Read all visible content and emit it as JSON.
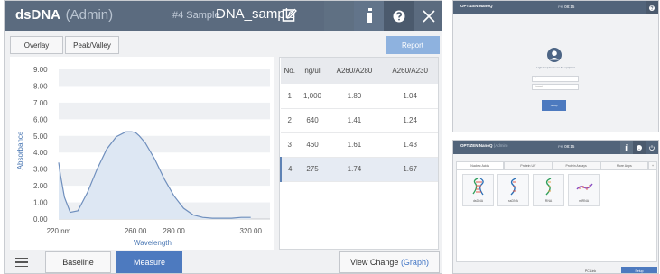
{
  "app": {
    "title": "dsDNA",
    "role": "(Admin)",
    "sample_no": "#4 Sample",
    "sample_name": "DNA_sample"
  },
  "toolbar": {
    "overlay_label": "Overlay",
    "peak_valley_label": "Peak/Valley",
    "report_label": "Report"
  },
  "chart_data": {
    "type": "line",
    "title": "",
    "xlabel": "Wavelength",
    "ylabel": "Absorbance",
    "xlim": [
      220,
      330
    ],
    "ylim": [
      0,
      9
    ],
    "x_tick_labels": [
      "220 nm",
      "260.00",
      "280.00",
      "320.00"
    ],
    "x_tick_values": [
      220,
      260,
      280,
      320
    ],
    "y_ticks": [
      "0.00",
      "1.00",
      "2.00",
      "3.00",
      "4.00",
      "5.00",
      "6.00",
      "7.00",
      "8.00",
      "9.00"
    ],
    "grid": "horizontal bands",
    "series": [
      {
        "x": [
          220,
          221,
          223,
          226,
          230,
          235,
          240,
          245,
          250,
          255,
          258,
          260,
          262,
          265,
          270,
          275,
          280,
          285,
          290,
          295,
          300,
          305,
          310,
          315,
          320
        ],
        "y": [
          3.4,
          2.6,
          1.3,
          0.4,
          0.5,
          1.6,
          3.0,
          4.2,
          4.95,
          5.25,
          5.25,
          5.2,
          5.0,
          4.6,
          3.6,
          2.4,
          1.4,
          0.65,
          0.25,
          0.1,
          0.05,
          0.05,
          0.05,
          0.1,
          0.1
        ]
      }
    ],
    "line_color": "#6f8fbd",
    "fill_color": "#dde7f3"
  },
  "table": {
    "headers": [
      "No.",
      "ng/ul",
      "A260/A280",
      "A260/A230"
    ],
    "rows": [
      [
        "1",
        "1,000",
        "1.80",
        "1.04"
      ],
      [
        "2",
        "640",
        "1.41",
        "1.24"
      ],
      [
        "3",
        "460",
        "1.61",
        "1.43"
      ],
      [
        "4",
        "275",
        "1.74",
        "1.67"
      ]
    ],
    "selected_row": 3
  },
  "bottom": {
    "baseline_label": "Baseline",
    "measure_label": "Measure",
    "view_change_label": "View Change",
    "view_change_mode": "(Graph)"
  },
  "login_screen": {
    "brand": "OPTIZEN NanoQ",
    "time_prefix": "PM",
    "time": "08:15",
    "prompt": "Login is required to use the equipment",
    "username_placeholder": "Username",
    "password_placeholder": "Password",
    "setup_label": "Setup"
  },
  "home_screen": {
    "brand": "OPTIZEN NanoQ",
    "role": "(Admin)",
    "time_prefix": "PM",
    "time": "08:15",
    "tabs": [
      "Nucleic Acids",
      "Protein UV",
      "Protein Assays",
      "More Apps"
    ],
    "tab_plus": "+",
    "tiles": [
      "dsDNA",
      "ssDNA",
      "RNA",
      "miRNA"
    ],
    "pc_link_label": "PC Link",
    "setup_label": "Setup"
  },
  "colors": {
    "titlebar": "#5b6b7f",
    "accent": "#4d7abf",
    "report_button": "#8eb2df"
  }
}
